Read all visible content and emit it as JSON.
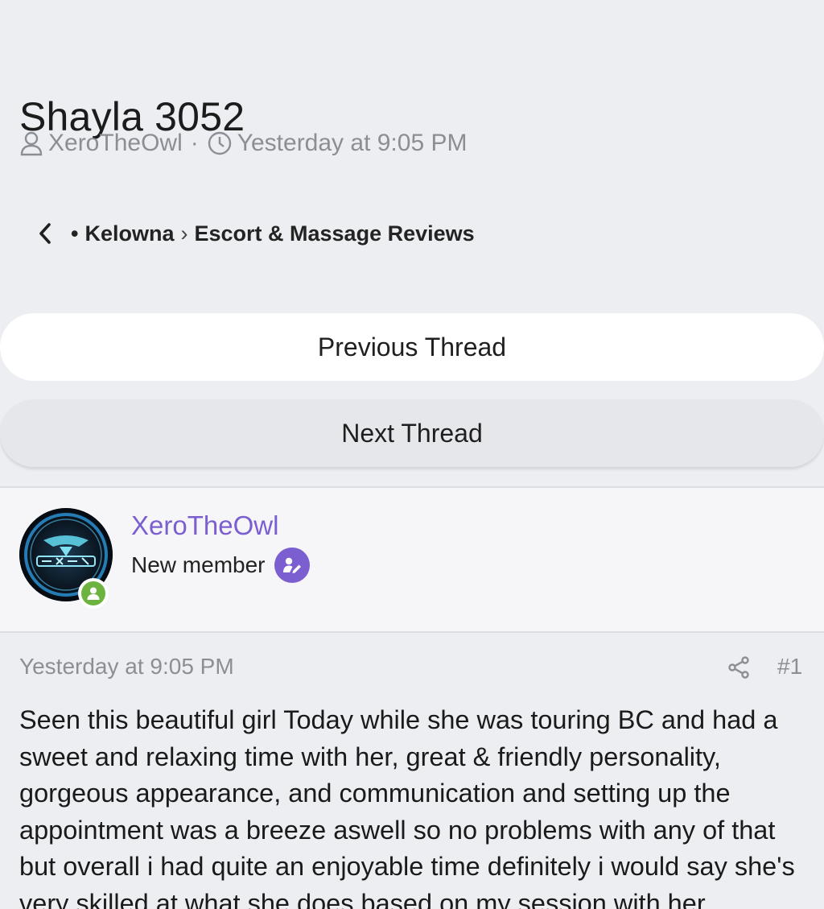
{
  "thread": {
    "title": "Shayla 3052",
    "author": "XeroTheOwl",
    "meta_separator": "·",
    "date": "Yesterday at 9:05 PM"
  },
  "breadcrumb": {
    "bullet": "•",
    "items": [
      "Kelowna",
      "Escort & Massage Reviews"
    ],
    "separator": "›"
  },
  "nav": {
    "previous_label": "Previous Thread",
    "next_label": "Next Thread"
  },
  "user": {
    "name": "XeroTheOwl",
    "title": "New member",
    "status": "online",
    "accent": "#7b5fd0",
    "online_color": "#6db33f"
  },
  "post": {
    "date": "Yesterday at 9:05 PM",
    "number": "#1",
    "body": "Seen this beautiful girl Today while she was touring BC and had a sweet and relaxing time with her, great & friendly personality, gorgeous appearance, and communication and setting up the appointment was a breeze aswell so no problems with any of that but overall i had quite an enjoyable time definitely i would say she's very skilled at what she does based on my session with her"
  },
  "icons": {
    "meta_author": "user-icon",
    "meta_date": "clock-icon",
    "back": "chevron-left-icon",
    "share": "share-icon",
    "role": "edit-badge-icon",
    "status": "online-icon"
  }
}
